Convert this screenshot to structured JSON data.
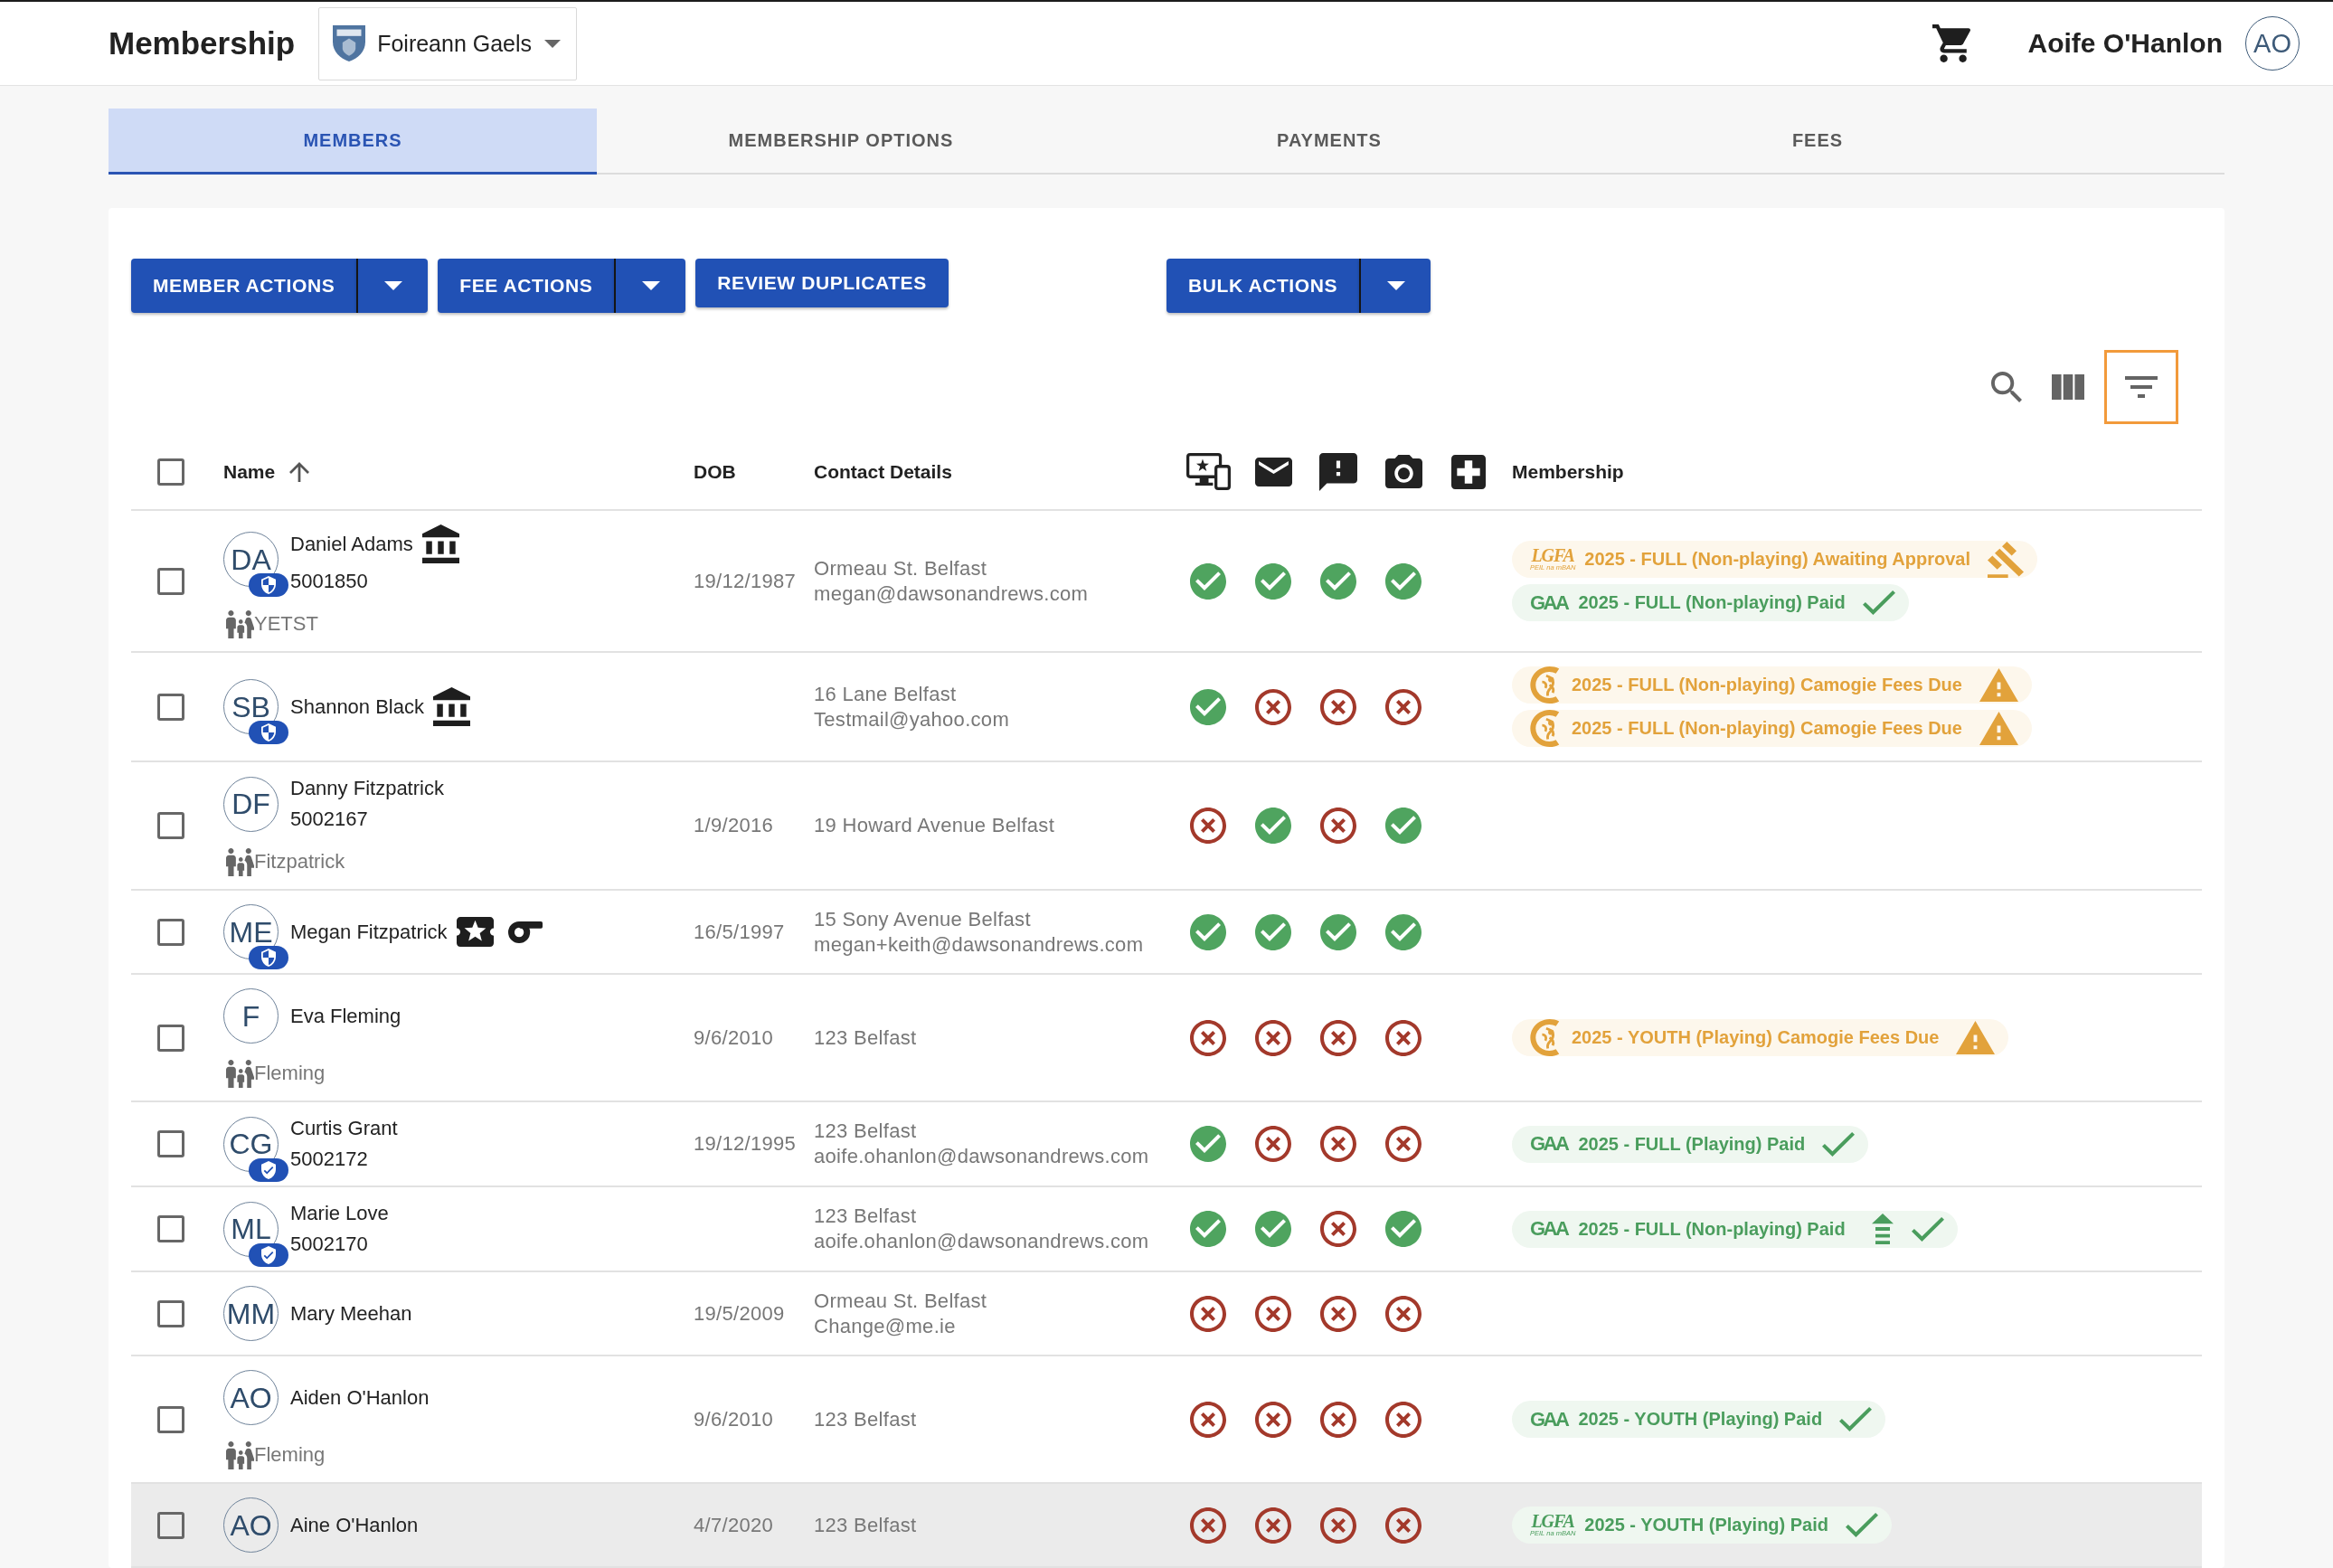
{
  "app_bar": {
    "title": "Membership",
    "club": "Foireann Gaels",
    "user_name": "Aoife O'Hanlon",
    "user_initials": "AO"
  },
  "tabs": [
    {
      "label": "MEMBERS",
      "selected": true
    },
    {
      "label": "MEMBERSHIP OPTIONS",
      "selected": false
    },
    {
      "label": "PAYMENTS",
      "selected": false
    },
    {
      "label": "FEES",
      "selected": false
    }
  ],
  "action_groups": [
    {
      "buttons": [
        {
          "label": "MEMBER ACTIONS",
          "kind": "split"
        },
        {
          "label": "FEE ACTIONS",
          "kind": "split"
        },
        {
          "label": "REVIEW DUPLICATES",
          "kind": "plain"
        }
      ]
    },
    {
      "buttons": [
        {
          "label": "BULK ACTIONS",
          "kind": "split"
        }
      ]
    }
  ],
  "toolbar": {
    "filter_highlighted": true
  },
  "table": {
    "select_all": {
      "checked": false
    },
    "columns": {
      "name": "Name",
      "dob": "DOB",
      "contact": "Contact Details",
      "membership": "Membership"
    },
    "sort_ascending": true,
    "rows": [
      {
        "checked": false,
        "hovered": false,
        "initials": "DA",
        "badge": {
          "kind": "shield"
        },
        "name": "Daniel Adams",
        "tags": [
          {
            "kind": "institution"
          }
        ],
        "member_id": "5001850",
        "family": "YETST",
        "dob": "19/12/1987",
        "contact": [
          "Ormeau St. Belfast",
          "megan@dawsonandrews.com"
        ],
        "checks": [
          true,
          true,
          true,
          true
        ],
        "memberships": [
          {
            "logo": {
              "kind": "script",
              "text": "LGFA",
              "subtext": "PEIL na mBAN"
            },
            "label": "2025 - FULL (Non-playing) Awaiting Approval",
            "kind": "pending",
            "upgrade": false
          },
          {
            "logo": {
              "kind": "wordmark",
              "text": "GAA"
            },
            "label": "2025 - FULL (Non-playing) Paid",
            "kind": "paid",
            "upgrade": false
          }
        ]
      },
      {
        "checked": false,
        "hovered": false,
        "initials": "SB",
        "badge": {
          "kind": "shield"
        },
        "name": "Shannon Black",
        "tags": [
          {
            "kind": "institution"
          }
        ],
        "contact": [
          "16 Lane Belfast",
          "Testmail@yahoo.com"
        ],
        "checks": [
          true,
          false,
          false,
          false
        ],
        "memberships": [
          {
            "logo": {
              "kind": "emblem"
            },
            "label": "2025 - FULL (Non-playing) Camogie Fees Due",
            "kind": "due",
            "upgrade": false
          },
          {
            "logo": {
              "kind": "emblem"
            },
            "label": "2025 - FULL (Non-playing) Camogie Fees Due",
            "kind": "due",
            "upgrade": false
          }
        ]
      },
      {
        "checked": false,
        "hovered": false,
        "initials": "DF",
        "name": "Danny Fitzpatrick",
        "member_id": "5002167",
        "family": "Fitzpatrick",
        "dob": "1/9/2016",
        "contact": [
          "19 Howard Avenue Belfast"
        ],
        "checks": [
          false,
          true,
          false,
          true
        ]
      },
      {
        "checked": false,
        "hovered": false,
        "initials": "ME",
        "badge": {
          "kind": "shield"
        },
        "name": "Megan Fitzpatrick",
        "tags": [
          {
            "kind": "ticket"
          },
          {
            "kind": "whistle"
          }
        ],
        "dob": "16/5/1997",
        "contact": [
          "15 Sony Avenue Belfast",
          "megan+keith@dawsonandrews.com"
        ],
        "checks": [
          true,
          true,
          true,
          true
        ]
      },
      {
        "checked": false,
        "hovered": false,
        "initials": "F",
        "name": "Eva Fleming",
        "family": "Fleming",
        "dob": "9/6/2010",
        "contact": [
          "123 Belfast"
        ],
        "checks": [
          false,
          false,
          false,
          false
        ],
        "memberships": [
          {
            "logo": {
              "kind": "emblem"
            },
            "label": "2025 - YOUTH (Playing) Camogie Fees Due",
            "kind": "due",
            "upgrade": false
          }
        ]
      },
      {
        "checked": false,
        "hovered": false,
        "initials": "CG",
        "badge": {
          "kind": "verified"
        },
        "name": "Curtis Grant",
        "member_id": "5002172",
        "dob": "19/12/1995",
        "contact": [
          "123 Belfast",
          "aoife.ohanlon@dawsonandrews.com"
        ],
        "checks": [
          true,
          false,
          false,
          false
        ],
        "memberships": [
          {
            "logo": {
              "kind": "wordmark",
              "text": "GAA"
            },
            "label": "2025 - FULL (Playing) Paid",
            "kind": "paid",
            "upgrade": false
          }
        ]
      },
      {
        "checked": false,
        "hovered": false,
        "initials": "ML",
        "badge": {
          "kind": "verified"
        },
        "name": "Marie Love",
        "member_id": "5002170",
        "contact": [
          "123 Belfast",
          "aoife.ohanlon@dawsonandrews.com"
        ],
        "checks": [
          true,
          true,
          false,
          true
        ],
        "memberships": [
          {
            "logo": {
              "kind": "wordmark",
              "text": "GAA"
            },
            "label": "2025 - FULL (Non-playing) Paid",
            "kind": "paid",
            "upgrade": true
          }
        ]
      },
      {
        "checked": false,
        "hovered": false,
        "initials": "MM",
        "name": "Mary Meehan",
        "dob": "19/5/2009",
        "contact": [
          "Ormeau St. Belfast",
          "Change@me.ie"
        ],
        "checks": [
          false,
          false,
          false,
          false
        ]
      },
      {
        "checked": false,
        "hovered": false,
        "initials": "AO",
        "name": "Aiden O'Hanlon",
        "family": "Fleming",
        "dob": "9/6/2010",
        "contact": [
          "123 Belfast"
        ],
        "checks": [
          false,
          false,
          false,
          false
        ],
        "memberships": [
          {
            "logo": {
              "kind": "wordmark",
              "text": "GAA"
            },
            "label": "2025 - YOUTH (Playing) Paid",
            "kind": "paid",
            "upgrade": false
          }
        ]
      },
      {
        "checked": false,
        "hovered": true,
        "initials": "AO",
        "name": "Aine O'Hanlon",
        "dob": "4/7/2020",
        "contact": [
          "123 Belfast"
        ],
        "checks": [
          false,
          false,
          false,
          false
        ],
        "memberships": [
          {
            "logo": {
              "kind": "script",
              "text": "LGFA",
              "subtext": "PEIL na mBAN"
            },
            "label": "2025 - YOUTH (Playing) Paid",
            "kind": "paid",
            "upgrade": false
          }
        ]
      }
    ]
  }
}
